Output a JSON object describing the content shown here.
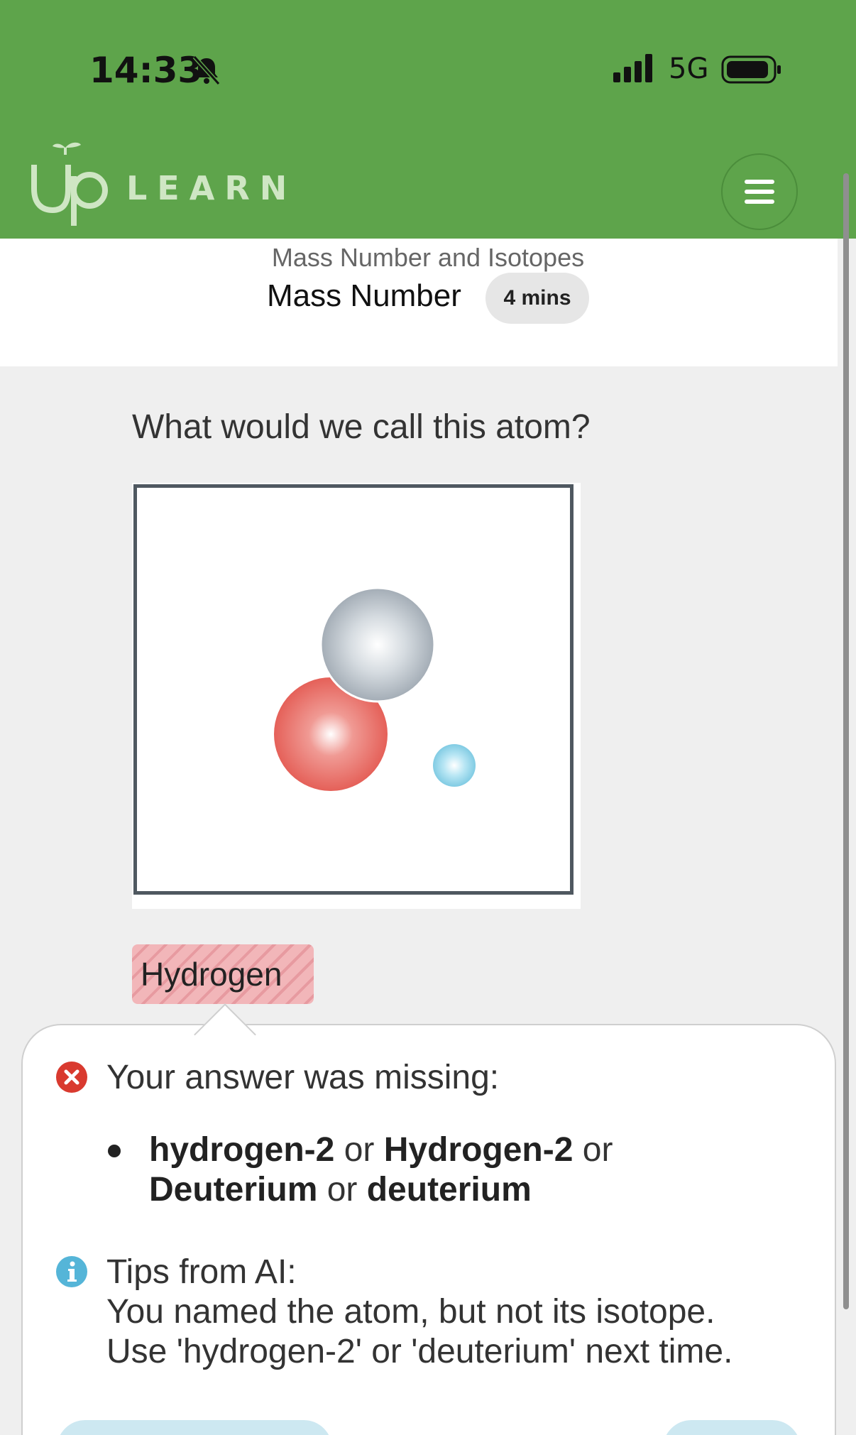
{
  "status_bar": {
    "time": "14:33",
    "network": "5G"
  },
  "brand": {
    "logo_up": "Up",
    "logo_learn": "LEARN",
    "header_color": "#5ea44b"
  },
  "lesson": {
    "topic": "Mass Number and Isotopes",
    "title": "Mass Number",
    "duration": "4 mins"
  },
  "question": {
    "prompt": "What would we call this atom?",
    "user_answer": "Hydrogen",
    "answer_state": "incorrect"
  },
  "atom_illustration": {
    "particles": [
      {
        "kind": "neutron",
        "color": "#b8c0c8"
      },
      {
        "kind": "proton",
        "color": "#e8625b"
      },
      {
        "kind": "electron",
        "color": "#8fd3ea"
      }
    ]
  },
  "feedback": {
    "missing_heading": "Your answer was missing:",
    "accepted_answers": [
      {
        "text": "hydrogen-2",
        "bold": true
      },
      {
        "text": " or ",
        "bold": false
      },
      {
        "text": "Hydrogen-2",
        "bold": true
      },
      {
        "text": " or",
        "bold": false
      },
      {
        "text": "Deuterium",
        "bold": true
      },
      {
        "text": " or ",
        "bold": false
      },
      {
        "text": "deuterium",
        "bold": true
      }
    ],
    "tips_heading": "Tips from AI:",
    "tips_lines": [
      "You named the atom, but not its isotope.",
      "Use 'hydrogen-2' or 'deuterium' next time."
    ],
    "error_color": "#d93a2f",
    "info_color": "#55b5d8"
  }
}
